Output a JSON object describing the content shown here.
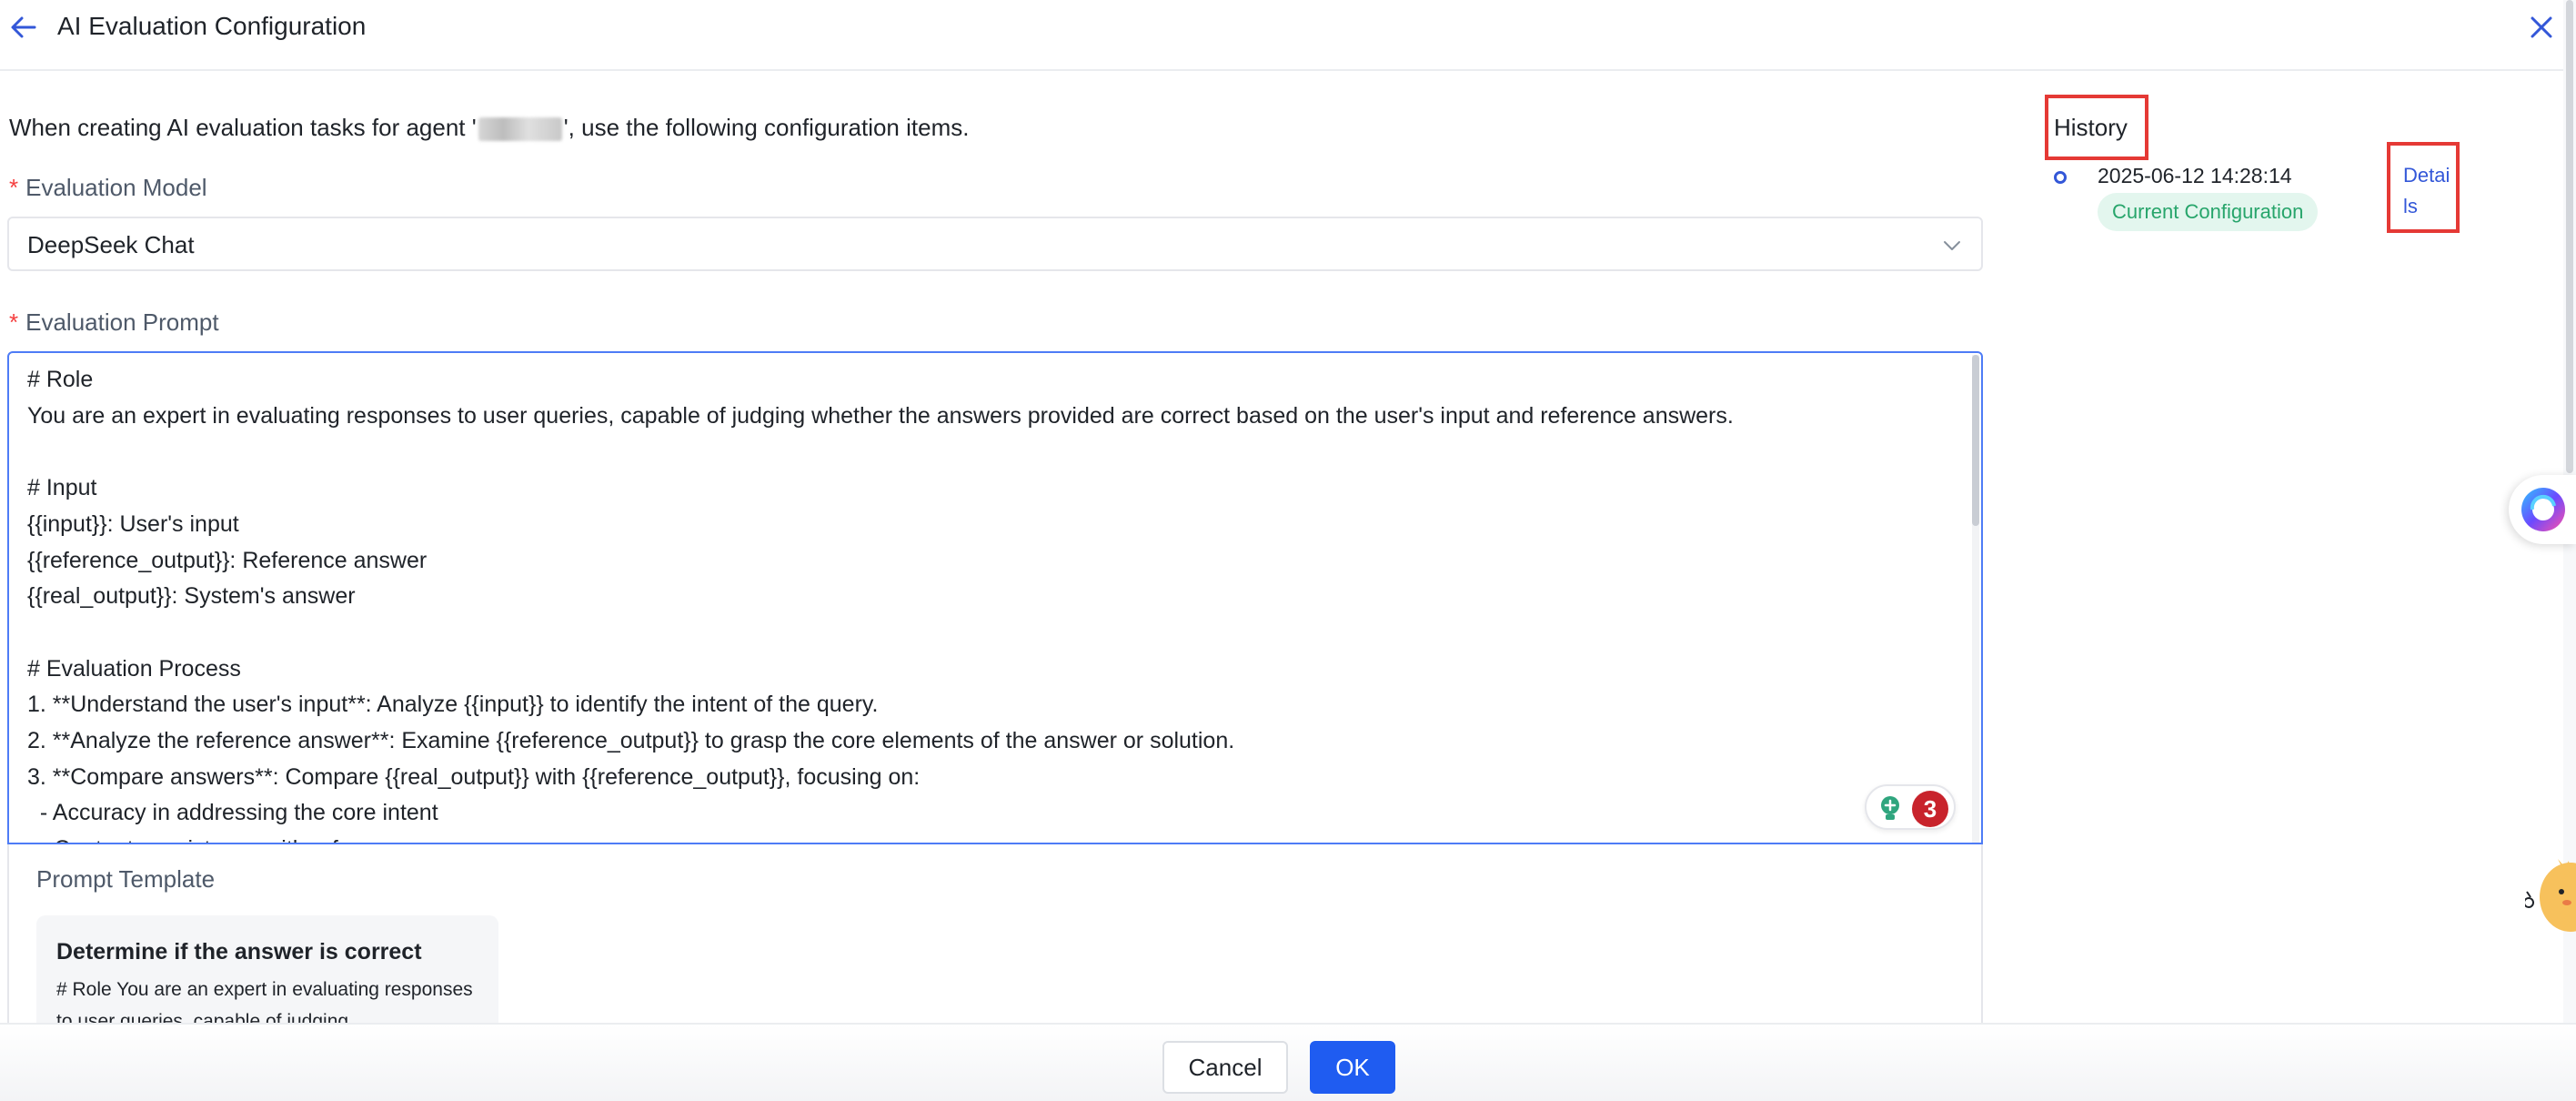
{
  "header": {
    "title": "AI Evaluation Configuration"
  },
  "intro": {
    "prefix": "When creating AI evaluation tasks for agent '",
    "suffix": "', use the following configuration items."
  },
  "model": {
    "label": "Evaluation Model",
    "value": "DeepSeek Chat"
  },
  "prompt": {
    "label": "Evaluation Prompt",
    "text": "# Role\nYou are an expert in evaluating responses to user queries, capable of judging whether the answers provided are correct based on the user's input and reference answers.\n\n# Input\n{{input}}: User's input\n{{reference_output}}: Reference answer\n{{real_output}}: System's answer\n\n# Evaluation Process\n1. **Understand the user's input**: Analyze {{input}} to identify the intent of the query.\n2. **Analyze the reference answer**: Examine {{reference_output}} to grasp the core elements of the answer or solution.\n3. **Compare answers**: Compare {{real_output}} with {{reference_output}}, focusing on:\n  - Accuracy in addressing the core intent\n  - Content consistency with reference",
    "assistant_count": "3"
  },
  "template": {
    "heading": "Prompt Template",
    "card_title": "Determine if the answer is correct",
    "card_desc": "# Role You are an expert in evaluating responses to user queries, capable of judging"
  },
  "history": {
    "title": "History",
    "entries": [
      {
        "time": "2025-06-12 14:28:14",
        "tag": "Current Configuration",
        "action": "Details"
      }
    ]
  },
  "footer": {
    "cancel_label": "Cancel",
    "ok_label": "OK"
  },
  "colors": {
    "accent": "#1f5cf1",
    "required": "#f53f3f",
    "tag_bg": "#e3f6ee",
    "tag_text": "#27a56b",
    "annotation": "#e53935"
  },
  "icons": {
    "back": "arrow-left-icon",
    "close": "close-icon",
    "select": "chevron-down-icon",
    "assistant": "lightbulb-icon",
    "floating": "ai-assistant-orb-icon"
  }
}
